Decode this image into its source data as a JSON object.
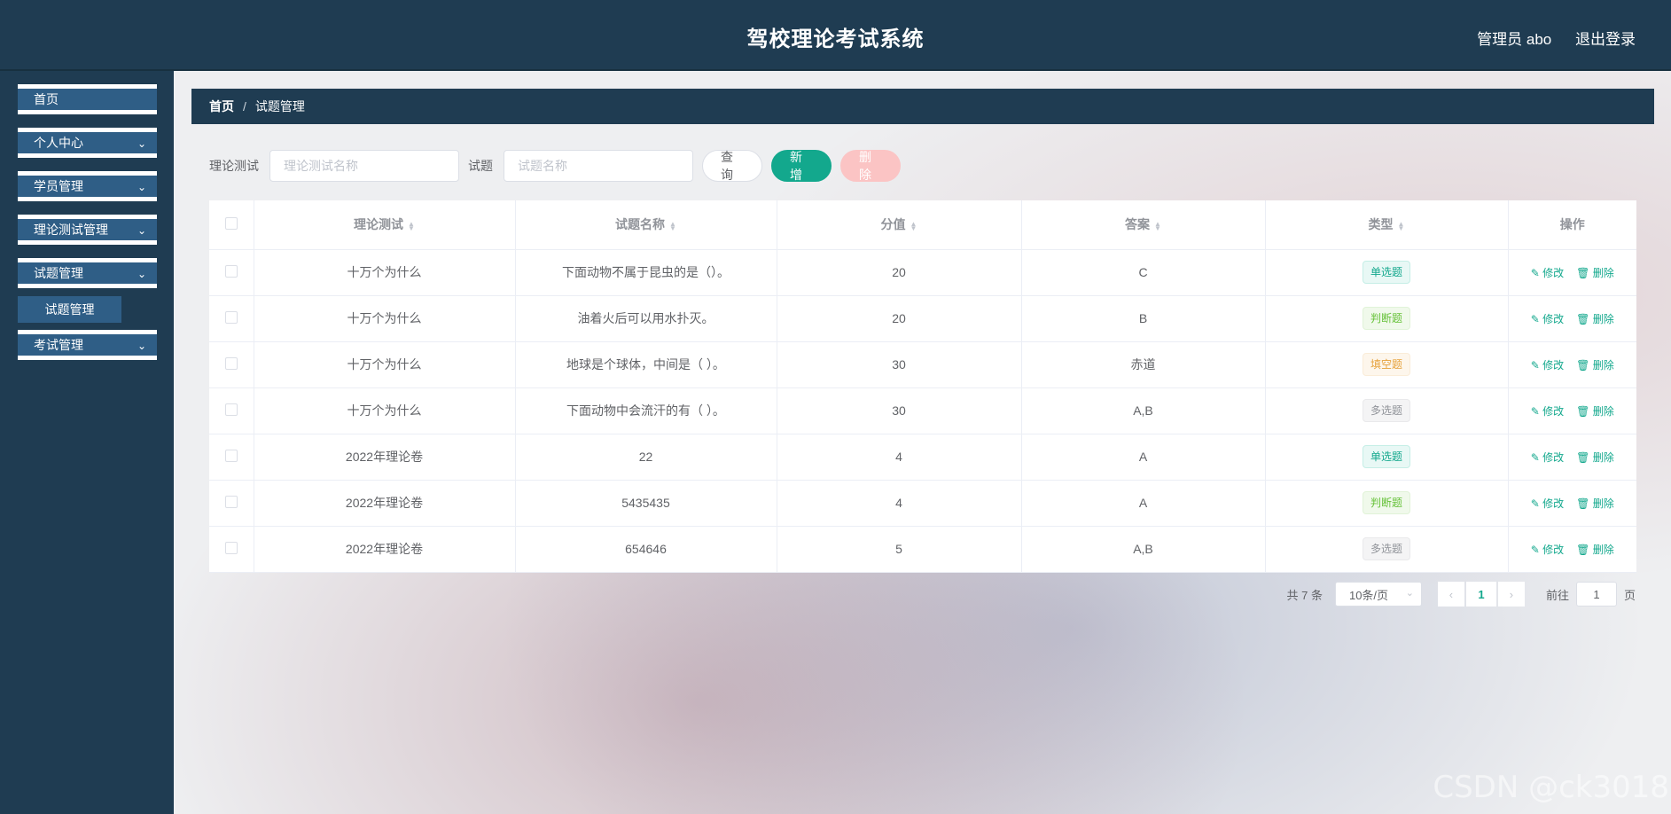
{
  "header": {
    "title": "驾校理论考试系统",
    "user": "管理员 abo",
    "logout": "退出登录"
  },
  "sidebar": {
    "items": [
      {
        "label": "首页"
      },
      {
        "label": "个人中心"
      },
      {
        "label": "学员管理"
      },
      {
        "label": "理论测试管理"
      },
      {
        "label": "试题管理"
      },
      {
        "label": "考试管理"
      }
    ],
    "submenu": {
      "label": "试题管理"
    }
  },
  "breadcrumb": {
    "home": "首页",
    "sep": "/",
    "current": "试题管理"
  },
  "filters": {
    "test_label": "理论测试",
    "test_placeholder": "理论测试名称",
    "question_label": "试题",
    "question_placeholder": "试题名称",
    "query": "查询",
    "add": "新增",
    "delete": "删除"
  },
  "table": {
    "columns": [
      "理论测试",
      "试题名称",
      "分值",
      "答案",
      "类型",
      "操作"
    ],
    "rows": [
      {
        "test": "十万个为什么",
        "question": "下面动物不属于昆虫的是（）。",
        "score": "20",
        "answer": "C",
        "type": "单选题",
        "type_color": "#13a88d"
      },
      {
        "test": "十万个为什么",
        "question": "油着火后可以用水扑灭。",
        "score": "20",
        "answer": "B",
        "type": "判断题",
        "type_color": "#67c23a"
      },
      {
        "test": "十万个为什么",
        "question": "地球是个球体，中间是（ ）。",
        "score": "30",
        "answer": "赤道",
        "type": "填空题",
        "type_color": "#e6a23c"
      },
      {
        "test": "十万个为什么",
        "question": "下面动物中会流汗的有（ ）。",
        "score": "30",
        "answer": "A,B",
        "type": "多选题",
        "type_color": "#909399"
      },
      {
        "test": "2022年理论卷",
        "question": "22",
        "score": "4",
        "answer": "A",
        "type": "单选题",
        "type_color": "#13a88d"
      },
      {
        "test": "2022年理论卷",
        "question": "5435435",
        "score": "4",
        "answer": "A",
        "type": "判断题",
        "type_color": "#67c23a"
      },
      {
        "test": "2022年理论卷",
        "question": "654646",
        "score": "5",
        "answer": "A,B",
        "type": "多选题",
        "type_color": "#909399"
      }
    ],
    "edit_label": "✎ 修改",
    "delete_label": "🗑 删除"
  },
  "pagination": {
    "total": "共 7 条",
    "page_size": "10条/页",
    "current_page": "1",
    "goto_label": "前往",
    "goto_value": "1",
    "goto_suffix": "页"
  },
  "watermark": "CSDN @ck3018",
  "colors": {
    "primary": "#13a88d",
    "nav": "#1f3c52",
    "menu": "#2f5e86",
    "danger_light": "#fbc4c4"
  }
}
